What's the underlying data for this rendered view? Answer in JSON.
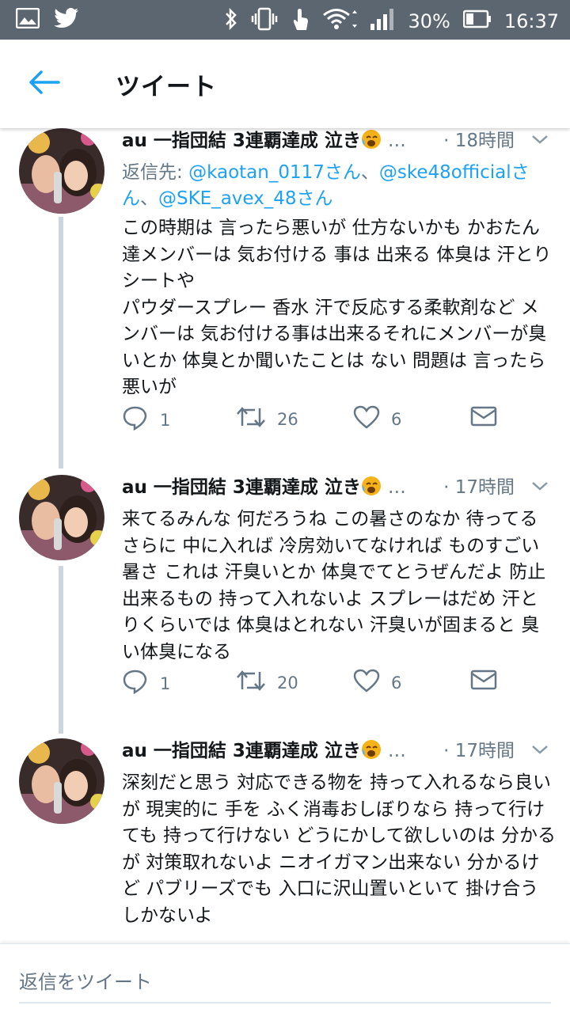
{
  "status_bar": {
    "battery": "30%",
    "time": "16:37"
  },
  "header": {
    "title": "ツイート"
  },
  "tweets": [
    {
      "name": "au 一指団結 3連覇達成 泣き",
      "handle": "…",
      "time": "· 18時間",
      "reply_prefix": "返信先: ",
      "mentions": [
        "@kaotan_0117さん",
        "@ske48officialさん",
        "@SKE_avex_48さん"
      ],
      "text": "この時期は 言ったら悪いが 仕方ないかも かおたん 達メンバーは 気お付ける 事は 出来る 体臭は 汗とりシートや\nパウダースプレー 香水 汗で反応する柔軟剤など メンバーは 気お付ける事は出来るそれにメンバーが臭いとか 体臭とか聞いたことは ない 問題は 言ったら悪いが",
      "replies": "1",
      "retweets": "26",
      "likes": "6"
    },
    {
      "name": "au 一指団結 3連覇達成 泣き",
      "handle": "…",
      "time": "· 17時間",
      "text": "来てるみんな 何だろうね この暑さのなか 待ってる さらに 中に入れば 冷房効いてなければ ものすごい 暑さ これは 汗臭いとか 体臭でてとうぜんだよ 防止出来るもの 持って入れないよ スプレーはだめ 汗とりくらいでは 体臭はとれない 汗臭いが固まると 臭い体臭になる",
      "replies": "1",
      "retweets": "20",
      "likes": "6"
    },
    {
      "name": "au 一指団結 3連覇達成 泣き",
      "handle": "…",
      "time": "· 17時間",
      "text": "深刻だと思う 対応できる物を 持って入れるなら良いが 現実的に 手を ふく消毒おしぼりなら 持って行けても 持って行けない どうにかして欲しいのは 分かるが 対策取れないよ ニオイガマン出来ない 分かるけど パブリーズでも 入口に沢山置いといて 掛け合うしかないよ"
    }
  ],
  "composer": {
    "placeholder": "返信をツイート"
  },
  "colors": {
    "accent": "#1da1f2",
    "statusbar": "#5b6671",
    "secondary_text": "#657786",
    "thread_line": "#ccd6dd"
  }
}
